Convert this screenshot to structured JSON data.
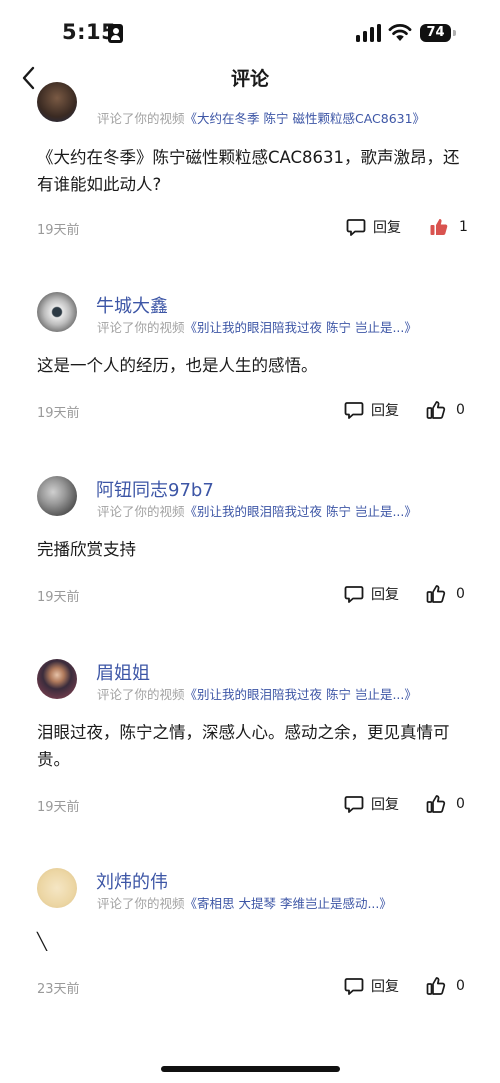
{
  "status_bar": {
    "time": "5:15",
    "battery": "74"
  },
  "nav": {
    "title": "评论"
  },
  "colors": {
    "link": "#3d56a6",
    "liked": "#d9534f"
  },
  "comments": [
    {
      "username": "",
      "ref_prefix": "评论了你的视频",
      "ref_title": "《大约在冬季 陈宁 磁性颗粒感CAC8631》",
      "text": "《大约在冬季》陈宁磁性颗粒感CAC8631，歌声激昂，还有谁能如此动人?",
      "time": "19天前",
      "reply_label": "回复",
      "likes": "1",
      "liked": true
    },
    {
      "username": "牛城大鑫",
      "ref_prefix": "评论了你的视频",
      "ref_title": "《别让我的眼泪陪我过夜 陈宁 岂止是...》",
      "text": "这是一个人的经历，也是人生的感悟。",
      "time": "19天前",
      "reply_label": "回复",
      "likes": "0",
      "liked": false
    },
    {
      "username": "阿钮同志97b7",
      "ref_prefix": "评论了你的视频",
      "ref_title": "《别让我的眼泪陪我过夜 陈宁 岂止是...》",
      "text": "完播欣赏支持",
      "time": "19天前",
      "reply_label": "回复",
      "likes": "0",
      "liked": false
    },
    {
      "username": "眉姐姐",
      "ref_prefix": "评论了你的视频",
      "ref_title": "《别让我的眼泪陪我过夜 陈宁 岂止是...》",
      "text": "泪眼过夜，陈宁之情，深感人心。感动之余，更见真情可贵。",
      "time": "19天前",
      "reply_label": "回复",
      "likes": "0",
      "liked": false
    },
    {
      "username": "刘炜的伟",
      "ref_prefix": "评论了你的视频",
      "ref_title": "《寄相思 大提琴 李维岂止是感动...》",
      "text": "╲",
      "time": "23天前",
      "reply_label": "回复",
      "likes": "0",
      "liked": false
    }
  ]
}
